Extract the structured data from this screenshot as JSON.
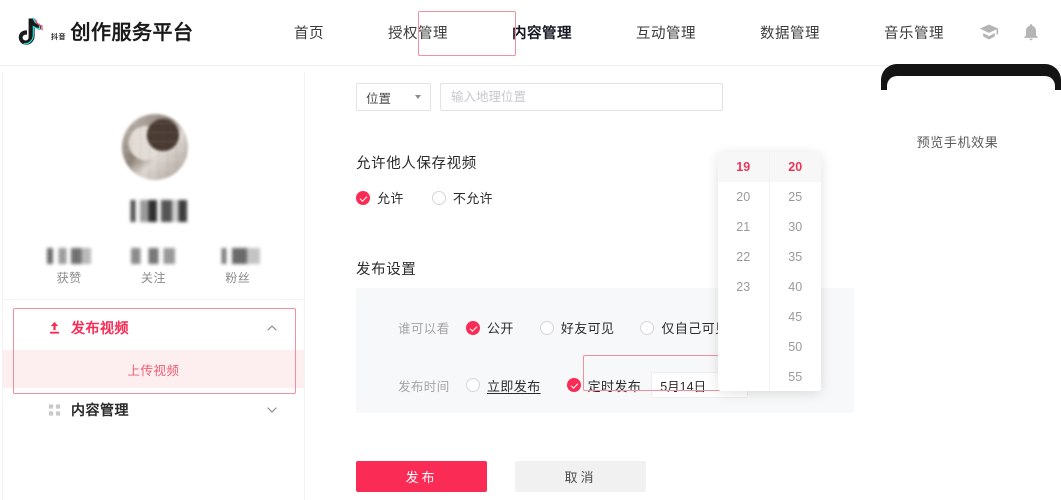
{
  "header": {
    "brand_sub": "抖音",
    "brand_title": "创作服务平台",
    "logo_icon": "douyin-note-icon",
    "nav": [
      {
        "label": "首页",
        "active": false
      },
      {
        "label": "授权管理",
        "active": false
      },
      {
        "label": "内容管理",
        "active": true
      },
      {
        "label": "互动管理",
        "active": false
      },
      {
        "label": "数据管理",
        "active": false
      },
      {
        "label": "音乐管理",
        "active": false
      }
    ],
    "icons": [
      {
        "name": "academy-cap-icon"
      },
      {
        "name": "bell-icon"
      }
    ]
  },
  "sidebar": {
    "stats": [
      {
        "label": "获赞"
      },
      {
        "label": "关注"
      },
      {
        "label": "粉丝"
      }
    ],
    "menu": [
      {
        "label": "发布视频",
        "icon": "upload-icon",
        "chevron": "chevron-up-icon",
        "active": true
      },
      {
        "label": "内容管理",
        "icon": "grid-icon",
        "chevron": "chevron-down-icon",
        "active": false
      }
    ],
    "submenu": [
      {
        "label": "上传视频",
        "selected": true
      }
    ]
  },
  "form": {
    "location": {
      "select_value": "位置",
      "input_placeholder": "输入地理位置",
      "input_value": ""
    },
    "allow_save": {
      "title": "允许他人保存视频",
      "options": [
        {
          "label": "允许",
          "selected": true
        },
        {
          "label": "不允许",
          "selected": false
        }
      ]
    },
    "publish": {
      "title": "发布设置",
      "who_can_see": {
        "key": "谁可以看",
        "options": [
          {
            "label": "公开",
            "selected": true
          },
          {
            "label": "好友可见",
            "selected": false
          },
          {
            "label": "仅自己可见",
            "selected": false
          }
        ]
      },
      "publish_time": {
        "key": "发布时间",
        "options": [
          {
            "label": "立即发布",
            "selected": false
          },
          {
            "label": "定时发布",
            "selected": true
          }
        ],
        "date_value": "5月14日",
        "calendar_icon": "calendar-icon"
      }
    },
    "actions": {
      "submit_label": "发布",
      "cancel_label": "取消"
    }
  },
  "time_picker": {
    "hours": [
      {
        "value": "19",
        "selected": true
      },
      {
        "value": "20",
        "selected": false
      },
      {
        "value": "21",
        "selected": false
      },
      {
        "value": "22",
        "selected": false
      },
      {
        "value": "23",
        "selected": false
      }
    ],
    "minutes": [
      {
        "value": "20",
        "selected": true
      },
      {
        "value": "25",
        "selected": false
      },
      {
        "value": "30",
        "selected": false
      },
      {
        "value": "35",
        "selected": false
      },
      {
        "value": "40",
        "selected": false
      },
      {
        "value": "45",
        "selected": false
      },
      {
        "value": "50",
        "selected": false
      },
      {
        "value": "55",
        "selected": false
      }
    ]
  },
  "preview": {
    "label": "预览手机效果"
  },
  "colors": {
    "accent": "#fa2c55",
    "highlight_border": "#f0909f",
    "submenu_bg": "#fdeef0",
    "panel_bg": "#f7f8f9"
  }
}
